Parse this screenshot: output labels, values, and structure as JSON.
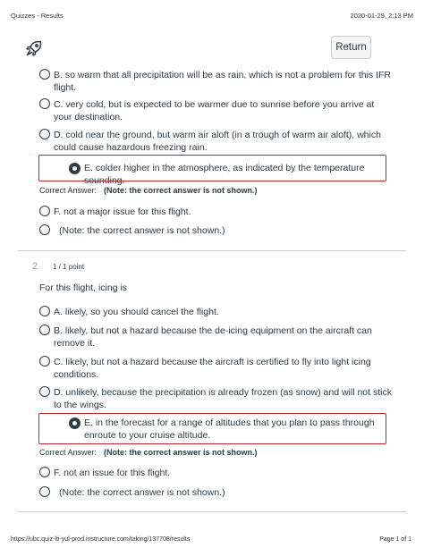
{
  "print_header": {
    "title": "Quizzes - Results",
    "datetime": "2020-01-29, 2:13 PM"
  },
  "print_footer": {
    "url": "https://ubc.quiz-lti-yul-prod.instructure.com/taking/137708/results",
    "page": "Page 1 of 1"
  },
  "header": {
    "return_label": "Return",
    "logo_icon": "rocket-icon"
  },
  "question1": {
    "options": [
      {
        "label": "B. so warm that all precipitation will be as rain, which is not a problem for this IFR flight."
      },
      {
        "label": "C. very cold, but is expected to be warmer due to sunrise before you arrive at your destination."
      },
      {
        "label": "D. cold near the ground, but warm air aloft (in a trough of warm air aloft), which could cause hazardous freezing rain."
      }
    ],
    "selected": "E. colder higher in the atmosphere, as indicated by the temperature sounding.",
    "correct_answer_label": "Correct Answer:",
    "correct_answer_note": "(Note: the correct answer is not shown.)",
    "after_options": [
      {
        "label": "F. not a major issue for this flight."
      },
      {
        "label": "(Note: the correct answer is not shown.)"
      }
    ]
  },
  "question2": {
    "number": "2",
    "score": "1 / 1 point",
    "text": "For this flight, icing is",
    "options": [
      {
        "label": "A. likely, so you should cancel the flight."
      },
      {
        "label": "B. likely, but not a hazard because the de-icing equipment on the aircraft can remove it."
      },
      {
        "label": "C. likely, but not a hazard because the aircraft is certified to fly into light icing conditions."
      },
      {
        "label": "D. unlikely, because the precipitation is already frozen (as snow) and will not stick to the wings."
      }
    ],
    "selected": "E. in the forecast for a range of altitudes that you plan to pass through enroute to your cruise altitude.",
    "correct_answer_label": "Correct Answer:",
    "correct_answer_note": "(Note: the correct answer is not shown.)",
    "after_options": [
      {
        "label": "F. not an issue for this flight."
      },
      {
        "label": "(Note: the correct answer is not shown.)"
      }
    ]
  },
  "colors": {
    "text": "#2d3b45",
    "selected_border": "#c4222a",
    "divider": "#c7cdd1"
  }
}
